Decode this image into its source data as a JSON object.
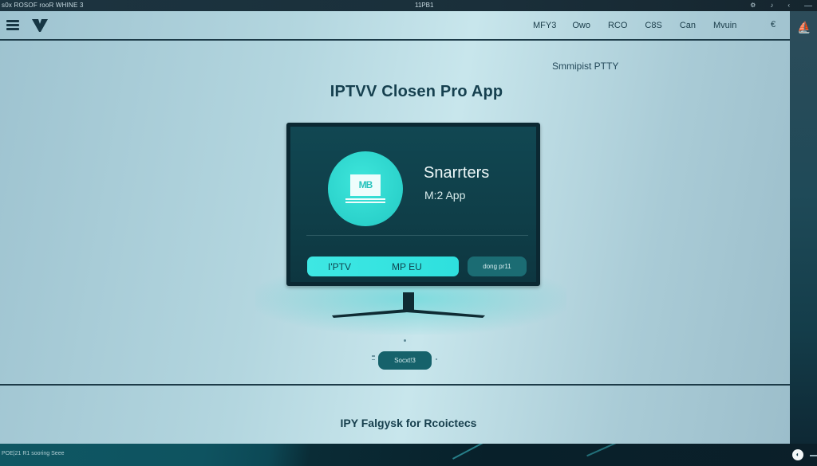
{
  "titlebar": {
    "left_text": "s0x ROSOF rooR WHINE 3",
    "center_text": "11PB1",
    "tray_icons": [
      "settings-icon",
      "audio-icon",
      "back-icon"
    ],
    "tray_glyphs": [
      "⚙",
      "♪",
      "‹"
    ]
  },
  "navbar": {
    "menu_icon": "hamburger-icon",
    "logo": "V",
    "links": [
      "MFY3",
      "Owo",
      "RCO",
      "C8S",
      "Can",
      "Mvuin"
    ],
    "extra_icon_glyph": "€"
  },
  "right_rail": {
    "icon_glyph": "⛵"
  },
  "main": {
    "tagline": "Smmipist PTTY",
    "title": "IPTVV Closen Pro App",
    "tv": {
      "app_icon_text": "MB",
      "app_name": "Snarrters",
      "app_subtitle": "M:2  App",
      "primary_button": {
        "left_label": "I'PTV",
        "right_label": "MP EU"
      },
      "secondary_button": "dong pr11"
    },
    "cta_button": "Socxt!3"
  },
  "footer": {
    "text": "IPY Falgysk for Rcoictecs"
  },
  "taskbar": {
    "status_text": "POE|21 R1 sooring Seee",
    "start_glyph": "◐"
  },
  "colors": {
    "accent_cyan": "#3ee6e0",
    "dark_teal": "#0b2832",
    "nav_text": "#1b3d4a",
    "secondary_btn": "#1b6c73"
  }
}
